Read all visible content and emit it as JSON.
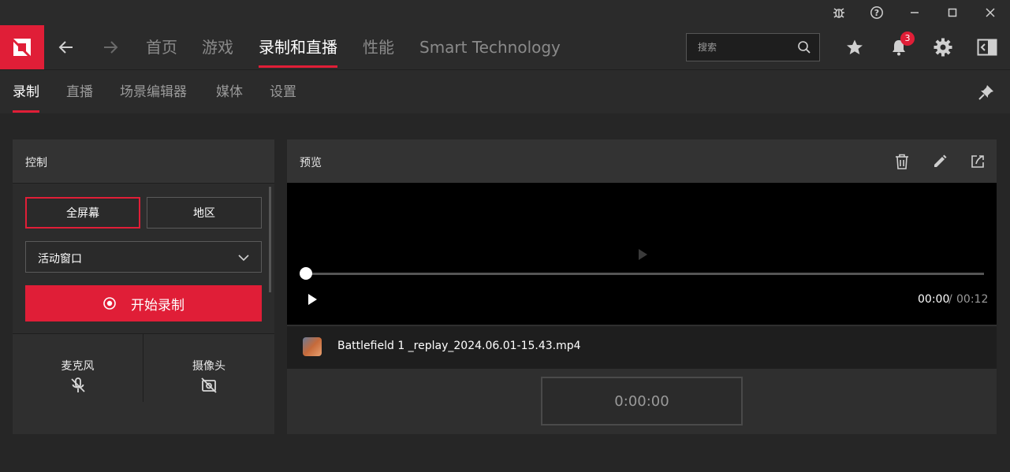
{
  "nav": {
    "items": [
      {
        "label": "首页"
      },
      {
        "label": "游戏"
      },
      {
        "label": "录制和直播"
      },
      {
        "label": "性能"
      },
      {
        "label": "Smart Technology"
      }
    ],
    "search_placeholder": "搜索",
    "notification_count": "3"
  },
  "subnav": {
    "items": [
      {
        "label": "录制"
      },
      {
        "label": "直播"
      },
      {
        "label": "场景编辑器"
      },
      {
        "label": "媒体"
      },
      {
        "label": "设置"
      }
    ]
  },
  "control_panel": {
    "title": "控制",
    "mode_fullscreen": "全屏幕",
    "mode_region": "地区",
    "window_select": "活动窗口",
    "record_button": "开始录制",
    "mic_label": "麦克风",
    "camera_label": "摄像头"
  },
  "preview_panel": {
    "title": "预览",
    "time_current": "00:00",
    "time_separator": "/",
    "time_total": "00:12",
    "file_name": "Battlefield 1 _replay_2024.06.01-15.43.mp4",
    "timer": "0:00:00"
  },
  "colors": {
    "accent": "#e01e37",
    "background": "#262626",
    "panel": "#2f2f2f"
  }
}
